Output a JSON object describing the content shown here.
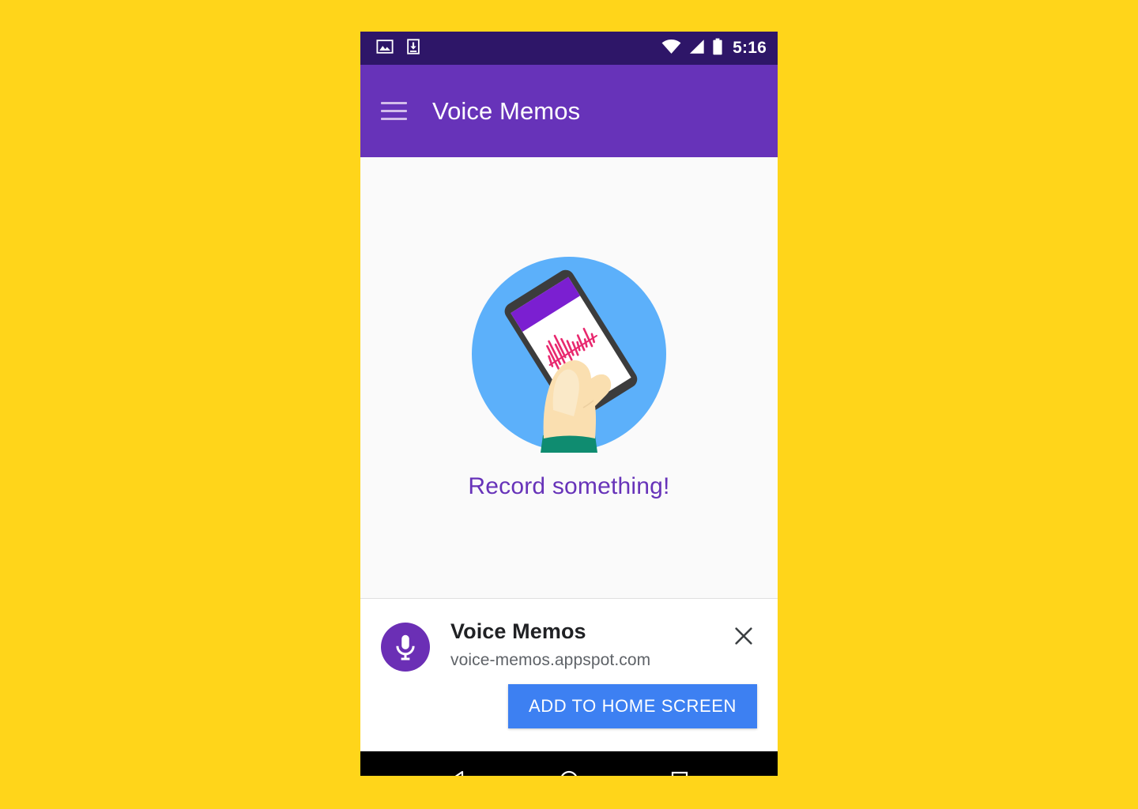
{
  "page": {
    "background_color": "#ffd51a"
  },
  "status_bar": {
    "background_color": "#2e1668",
    "clock": "5:16",
    "notification_icons": [
      "screenshot-image-icon",
      "download-icon"
    ],
    "system_icons": [
      "wifi-icon",
      "cellular-signal-icon",
      "battery-icon"
    ]
  },
  "app_bar": {
    "background_color": "#6733b9",
    "menu_icon": "hamburger-menu-icon",
    "title": "Voice Memos"
  },
  "content": {
    "background_color": "#fafafa",
    "illustration": {
      "name": "hand-holding-phone-recording-illustration",
      "circle_color": "#5cb0fa",
      "phone_body_color": "#3c3c3c",
      "phone_screen_color": "#ffffff",
      "phone_appbar_color": "#7b1fd1",
      "waveform_color": "#e8286e",
      "skin_color": "#fadfb0",
      "sleeve_color": "#0f8c70"
    },
    "empty_message": "Record something!",
    "empty_message_color": "#6733b9"
  },
  "install_banner": {
    "background_color": "#ffffff",
    "app_icon": "microphone-icon",
    "app_icon_background": "#6b2fb5",
    "app_name": "Voice Memos",
    "url": "voice-memos.appspot.com",
    "close_icon": "close-x-icon",
    "install_button_label": "ADD TO HOME SCREEN",
    "install_button_color": "#3d80f2"
  },
  "nav_bar": {
    "background_color": "#000000",
    "buttons": [
      {
        "name": "back-button",
        "icon": "triangle-back-icon"
      },
      {
        "name": "home-button",
        "icon": "circle-home-icon"
      },
      {
        "name": "recents-button",
        "icon": "square-recents-icon"
      }
    ]
  }
}
